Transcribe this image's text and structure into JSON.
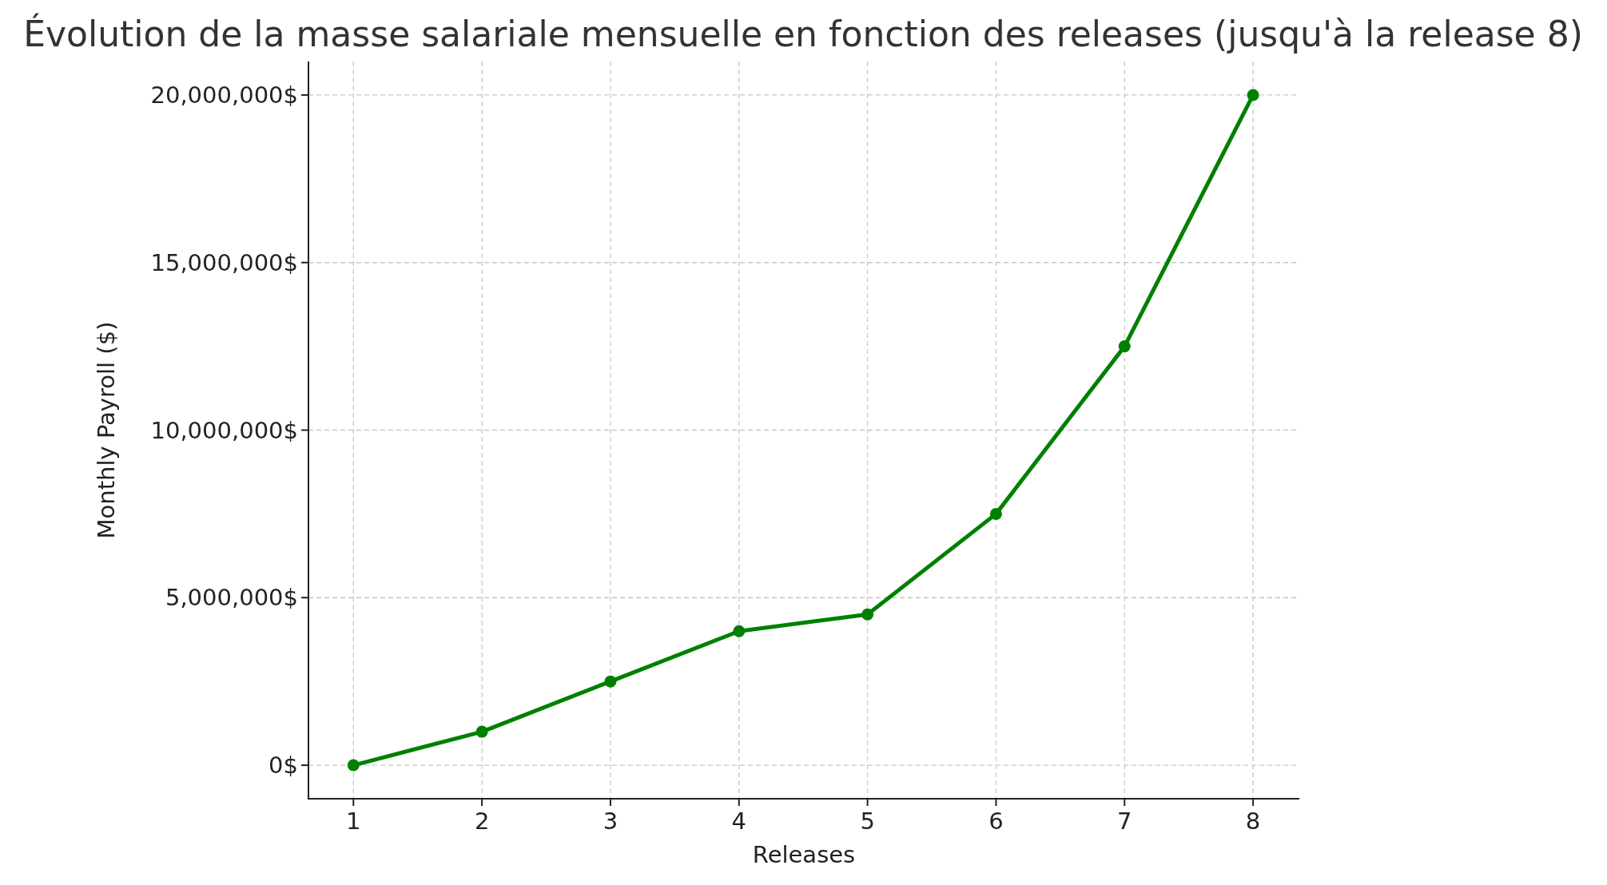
{
  "chart_data": {
    "type": "line",
    "title": "Évolution de la masse salariale mensuelle en fonction des releases (jusqu'à la release 8)",
    "xlabel": "Releases",
    "ylabel": "Monthly Payroll ($)",
    "x": [
      1,
      2,
      3,
      4,
      5,
      6,
      7,
      8
    ],
    "grid": true,
    "series": [
      {
        "color": "#008000",
        "marker": "o",
        "values": [
          0,
          1000000,
          2500000,
          4000000,
          4500000,
          7500000,
          12500000,
          20000000
        ]
      }
    ],
    "xlim": [
      0.65,
      8.36
    ],
    "ylim": [
      -1000000,
      21000000
    ],
    "xticks": [
      1,
      2,
      3,
      4,
      5,
      6,
      7,
      8
    ],
    "yticks": [
      {
        "value": 0,
        "label": "0$"
      },
      {
        "value": 5000000,
        "label": "5,000,000$"
      },
      {
        "value": 10000000,
        "label": "10,000,000$"
      },
      {
        "value": 15000000,
        "label": "15,000,000$"
      },
      {
        "value": 20000000,
        "label": "20,000,000$"
      }
    ]
  }
}
